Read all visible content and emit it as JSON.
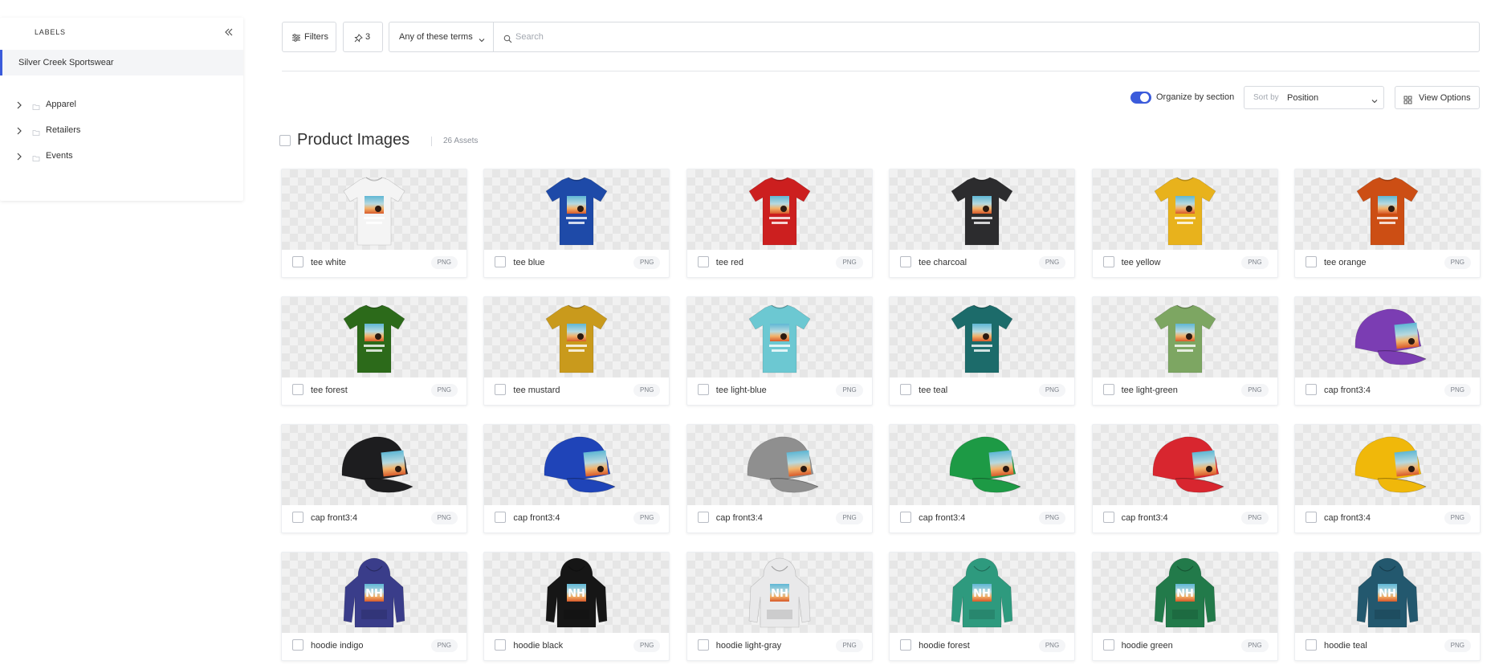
{
  "sidebar": {
    "title": "LABELS",
    "root_label": "Silver Creek Sportswear",
    "items": [
      {
        "label": "Apparel"
      },
      {
        "label": "Retailers"
      },
      {
        "label": "Events"
      }
    ]
  },
  "toolbar": {
    "filters_label": "Filters",
    "pinned_count": "3",
    "terms_label": "Any of these terms",
    "search_placeholder": "Search",
    "search_value": ""
  },
  "controls": {
    "organize_label": "Organize by section",
    "organize_on": true,
    "sort_prefix": "Sort by",
    "sort_value": "Position",
    "view_options_label": "View Options"
  },
  "section": {
    "title": "Product Images",
    "count_label": "26 Assets"
  },
  "colors": {
    "accent": "#3b5bdb"
  },
  "assets": [
    {
      "name": "tee white",
      "format": "PNG",
      "kind": "tee",
      "color": "#f4f4f4"
    },
    {
      "name": "tee blue",
      "format": "PNG",
      "kind": "tee",
      "color": "#1e4aa8"
    },
    {
      "name": "tee red",
      "format": "PNG",
      "kind": "tee",
      "color": "#cc1f1f"
    },
    {
      "name": "tee charcoal",
      "format": "PNG",
      "kind": "tee",
      "color": "#2c2c2e"
    },
    {
      "name": "tee yellow",
      "format": "PNG",
      "kind": "tee",
      "color": "#e8b21c"
    },
    {
      "name": "tee orange",
      "format": "PNG",
      "kind": "tee",
      "color": "#cc4e14"
    },
    {
      "name": "tee forest",
      "format": "PNG",
      "kind": "tee",
      "color": "#2c6a1a"
    },
    {
      "name": "tee mustard",
      "format": "PNG",
      "kind": "tee",
      "color": "#c99a1c"
    },
    {
      "name": "tee light-blue",
      "format": "PNG",
      "kind": "tee",
      "color": "#6cc8d2"
    },
    {
      "name": "tee teal",
      "format": "PNG",
      "kind": "tee",
      "color": "#1c6b6a"
    },
    {
      "name": "tee light-green",
      "format": "PNG",
      "kind": "tee",
      "color": "#7da662"
    },
    {
      "name": "cap front3:4",
      "format": "PNG",
      "kind": "cap",
      "color": "#7b3db3"
    },
    {
      "name": "cap front3:4",
      "format": "PNG",
      "kind": "cap",
      "color": "#1d1d1f"
    },
    {
      "name": "cap front3:4",
      "format": "PNG",
      "kind": "cap",
      "color": "#1f44b8"
    },
    {
      "name": "cap front3:4",
      "format": "PNG",
      "kind": "cap",
      "color": "#8f8f8f"
    },
    {
      "name": "cap front3:4",
      "format": "PNG",
      "kind": "cap",
      "color": "#1d9a45"
    },
    {
      "name": "cap front3:4",
      "format": "PNG",
      "kind": "cap",
      "color": "#d8262f"
    },
    {
      "name": "cap front3:4",
      "format": "PNG",
      "kind": "cap",
      "color": "#f0b80a"
    },
    {
      "name": "hoodie indigo",
      "format": "PNG",
      "kind": "hoodie",
      "color": "#3a3d8a"
    },
    {
      "name": "hoodie black",
      "format": "PNG",
      "kind": "hoodie",
      "color": "#161616"
    },
    {
      "name": "hoodie light-gray",
      "format": "PNG",
      "kind": "hoodie",
      "color": "#e9e9ea"
    },
    {
      "name": "hoodie forest",
      "format": "PNG",
      "kind": "hoodie",
      "color": "#2e9a7e"
    },
    {
      "name": "hoodie green",
      "format": "PNG",
      "kind": "hoodie",
      "color": "#227a4a"
    },
    {
      "name": "hoodie teal",
      "format": "PNG",
      "kind": "hoodie",
      "color": "#23586e"
    }
  ]
}
